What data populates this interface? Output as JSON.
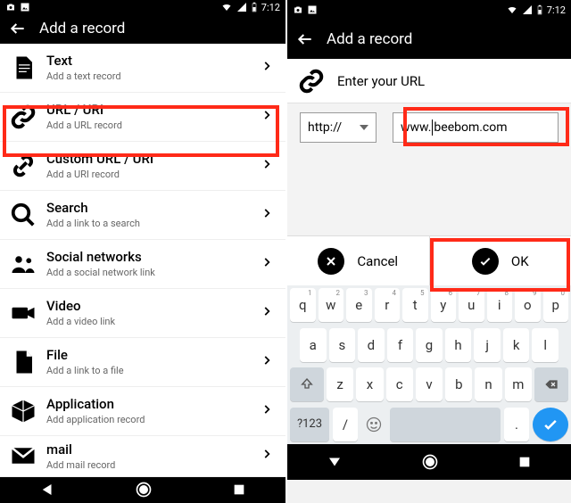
{
  "status": {
    "time": "7:12"
  },
  "appbar": {
    "title": "Add a record"
  },
  "list": [
    {
      "title": "Text",
      "sub": "Add a text record"
    },
    {
      "title": "URL / URI",
      "sub": "Add a URL record"
    },
    {
      "title": "Custom URL / URI",
      "sub": "Add a URI record"
    },
    {
      "title": "Search",
      "sub": "Add a link to a search"
    },
    {
      "title": "Social networks",
      "sub": "Add a social network link"
    },
    {
      "title": "Video",
      "sub": "Add a video link"
    },
    {
      "title": "File",
      "sub": "Add a link to a file"
    },
    {
      "title": "Application",
      "sub": "Add application record"
    },
    {
      "title": "mail",
      "sub": "Add mail record"
    }
  ],
  "url_panel": {
    "header": "Enter your URL",
    "protocol": "http://",
    "url_pre": "www.",
    "url_post": "beebom.com",
    "cancel": "Cancel",
    "ok": "OK"
  },
  "keyboard": {
    "r1": [
      "q",
      "w",
      "e",
      "r",
      "t",
      "y",
      "u",
      "i",
      "o",
      "p"
    ],
    "r1s": [
      "1",
      "2",
      "3",
      "4",
      "5",
      "6",
      "7",
      "8",
      "9",
      "0"
    ],
    "r2": [
      "a",
      "s",
      "d",
      "f",
      "g",
      "h",
      "j",
      "k",
      "l"
    ],
    "r3": [
      "z",
      "x",
      "c",
      "v",
      "b",
      "n",
      "m"
    ],
    "sym": "?123",
    "slash": "/",
    "dot": "."
  }
}
